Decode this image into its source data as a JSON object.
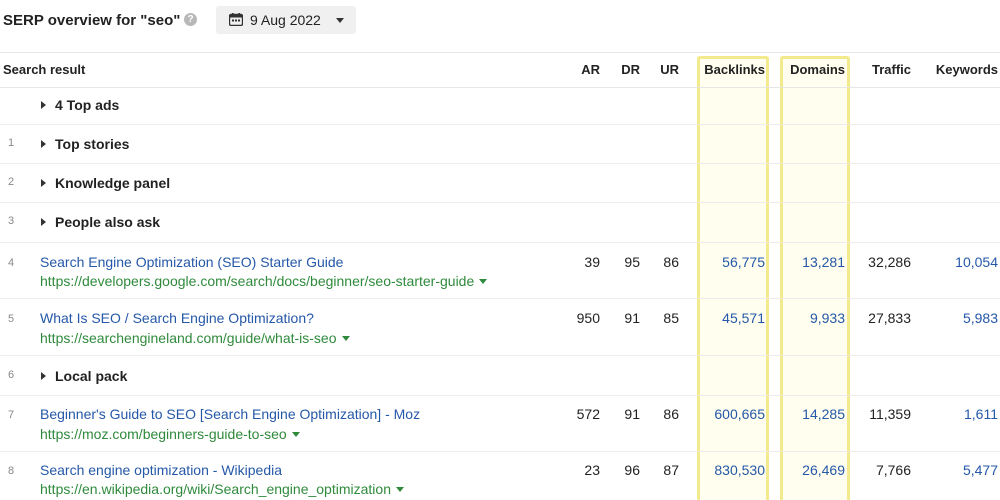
{
  "header": {
    "title": "SERP overview for \"seo\"",
    "help_glyph": "?",
    "date": "9 Aug 2022"
  },
  "colors": {
    "highlight": "#f2ea8c",
    "link": "#2558a8",
    "url": "#2f8a3c"
  },
  "columns": [
    "Search result",
    "AR",
    "DR",
    "UR",
    "Backlinks",
    "Domains",
    "Traffic",
    "Keywords"
  ],
  "rows": [
    {
      "type": "section",
      "num": "",
      "label": "4 Top ads"
    },
    {
      "type": "section",
      "num": "1",
      "label": "Top stories"
    },
    {
      "type": "section",
      "num": "2",
      "label": "Knowledge panel"
    },
    {
      "type": "section",
      "num": "3",
      "label": "People also ask"
    },
    {
      "type": "result",
      "num": "4",
      "title": "Search Engine Optimization (SEO) Starter Guide",
      "url": "https://developers.google.com/search/docs/beginner/seo-starter-guide",
      "ar": "39",
      "dr": "95",
      "ur": "86",
      "backlinks": "56,775",
      "domains": "13,281",
      "traffic": "32,286",
      "keywords": "10,054"
    },
    {
      "type": "result",
      "num": "5",
      "title": "What Is SEO / Search Engine Optimization?",
      "url": "https://searchengineland.com/guide/what-is-seo",
      "ar": "950",
      "dr": "91",
      "ur": "85",
      "backlinks": "45,571",
      "domains": "9,933",
      "traffic": "27,833",
      "keywords": "5,983"
    },
    {
      "type": "section",
      "num": "6",
      "label": "Local pack"
    },
    {
      "type": "result",
      "num": "7",
      "title": "Beginner's Guide to SEO [Search Engine Optimization] - Moz",
      "url": "https://moz.com/beginners-guide-to-seo",
      "ar": "572",
      "dr": "91",
      "ur": "86",
      "backlinks": "600,665",
      "domains": "14,285",
      "traffic": "11,359",
      "keywords": "1,611"
    },
    {
      "type": "result",
      "num": "8",
      "title": "Search engine optimization - Wikipedia",
      "url": "https://en.wikipedia.org/wiki/Search_engine_optimization",
      "ar": "23",
      "dr": "96",
      "ur": "87",
      "backlinks": "830,530",
      "domains": "26,469",
      "traffic": "7,766",
      "keywords": "5,477"
    }
  ]
}
